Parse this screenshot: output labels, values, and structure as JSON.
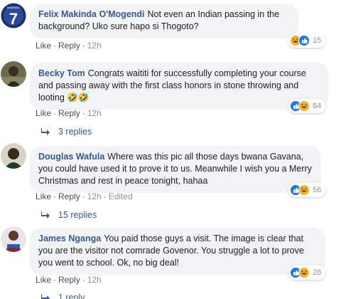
{
  "comments": [
    {
      "author": "Felix Makinda O'Mogendi",
      "text": "Not even an Indian passing in the background? Uko sure hapo si Thogoto?",
      "actions": {
        "like": "Like",
        "reply": "Reply",
        "time": "12h"
      },
      "reactions": {
        "count": "15"
      },
      "avatar_badge": {
        "top": "MAKINDA",
        "number": "7"
      }
    },
    {
      "author": "Becky Tom",
      "text": "Congrats waititi for successfully completing your course and passing away with the first class honors in stone throwing and looting 🤣🤣",
      "actions": {
        "like": "Like",
        "reply": "Reply",
        "time": "12h"
      },
      "reactions": {
        "count": "64"
      },
      "replies_label": "3 replies"
    },
    {
      "author": "Douglas Wafula",
      "text": "Where was this pic all those days bwana Gavana, you could have used it to prove it to us. Meanwhile I wish you a Merry Christmas and rest in peace tonight, hahaa",
      "actions": {
        "like": "Like",
        "reply": "Reply",
        "time": "12h",
        "edited": "Edited"
      },
      "reactions": {
        "count": "56"
      },
      "replies_label": "15 replies"
    },
    {
      "author": "James Nganga",
      "text": "You paid those guys a visit. The image is clear that you are the visitor not comrade Govenor. You struggle a lot to prove you went to school. Ok, no big deal!",
      "actions": {
        "like": "Like",
        "reply": "Reply",
        "time": "12h"
      },
      "reactions": {
        "count": "28"
      },
      "replies_label": "1 reply"
    }
  ],
  "colors": {
    "author": "#385898",
    "bubble": "#f2f3f5",
    "like": "#1877f2",
    "haha": "#f7b125"
  }
}
